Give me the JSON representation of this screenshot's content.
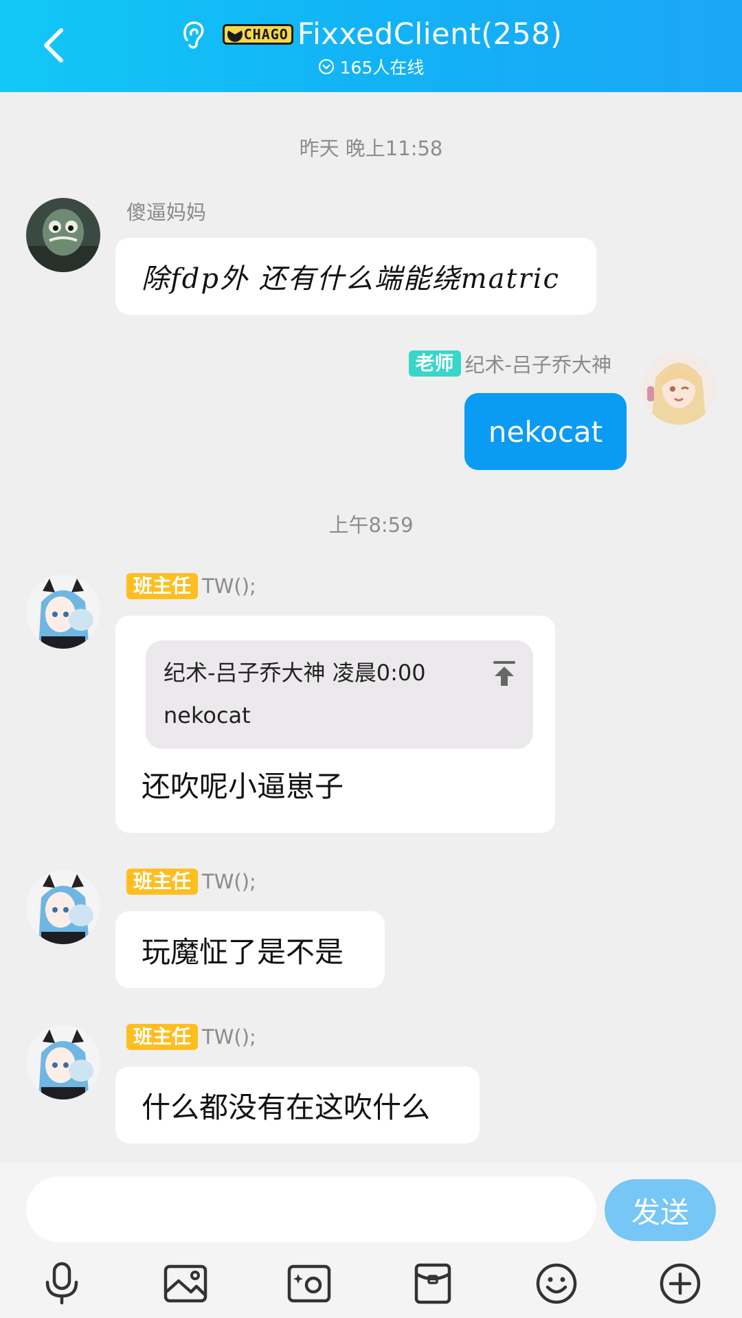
{
  "header": {
    "logo_text": "CHAGO",
    "title": "FixxedClient(258)",
    "online": "165人在线"
  },
  "timestamps": [
    "昨天 晚上11:58",
    "上午8:59"
  ],
  "messages": [
    {
      "sender": "傻逼妈妈",
      "text": "除fdp外 还有什么端能绕matric"
    },
    {
      "tag": "老师",
      "sender": "纪术-吕子乔大神",
      "text": "nekocat"
    },
    {
      "tag": "班主任",
      "sender": "TW();",
      "quote_meta": "纪术-吕子乔大神 凌晨0:00",
      "quote_text": "nekocat",
      "text": "还吹呢小逼崽子"
    },
    {
      "tag": "班主任",
      "sender": "TW();",
      "text": "玩魔怔了是不是"
    },
    {
      "tag": "班主任",
      "sender": "TW();",
      "text": "什么都没有在这吹什么"
    }
  ],
  "input": {
    "placeholder": "",
    "send_label": "发送"
  },
  "toolbar": [
    "microphone-icon",
    "image-icon",
    "camera-icon",
    "red-packet-icon",
    "emoji-icon",
    "plus-icon"
  ],
  "colors": {
    "header": "#12b3f6",
    "blue_bubble": "#0a9bf5",
    "tag_yellow": "#ffbe1f",
    "tag_teal": "#38d6c8",
    "send": "#76c6f6"
  }
}
